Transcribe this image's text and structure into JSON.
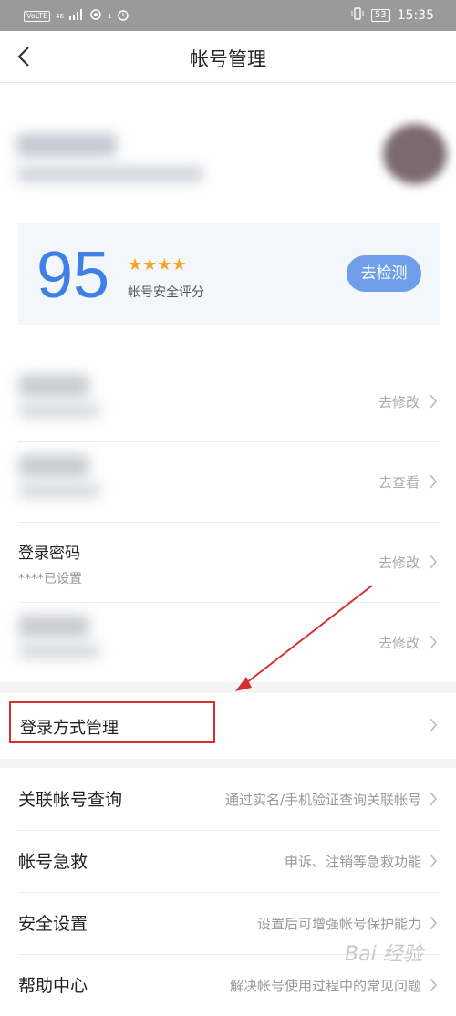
{
  "status_bar": {
    "left_tag": "VoLTE",
    "signal_text": "46",
    "signal_sub": "1",
    "battery": "53",
    "time": "15:35"
  },
  "nav": {
    "title": "帐号管理"
  },
  "score_card": {
    "score": "95",
    "stars": "★★★★",
    "label": "帐号安全评分",
    "button": "去检测"
  },
  "rows": [
    {
      "title": "",
      "sub": "",
      "action": "去修改"
    },
    {
      "title": "",
      "sub": "",
      "action": "去查看"
    },
    {
      "title": "登录密码",
      "sub": "****已设置",
      "action": "去修改"
    },
    {
      "title": "",
      "sub": "",
      "action": "去修改"
    }
  ],
  "login_method": {
    "title": "登录方式管理"
  },
  "menu": [
    {
      "title": "关联帐号查询",
      "desc": "通过实名/手机验证查询关联帐号"
    },
    {
      "title": "帐号急救",
      "desc": "申诉、注销等急救功能"
    },
    {
      "title": "安全设置",
      "desc": "设置后可增强帐号保护能力"
    },
    {
      "title": "帮助中心",
      "desc": "解决帐号使用过程中的常见问题"
    }
  ],
  "watermark": "Bai 经验",
  "colors": {
    "accent": "#3e80e6",
    "button": "#6f9fea",
    "star": "#f5a623",
    "annotation": "#d43030"
  }
}
